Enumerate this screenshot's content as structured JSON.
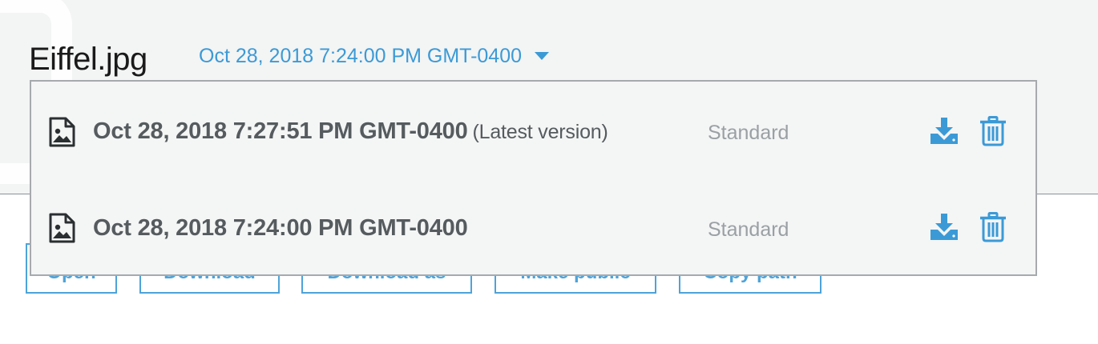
{
  "file": {
    "name": "Eiffel.jpg"
  },
  "version_selector": {
    "selected": "Oct 28, 2018 7:24:00 PM GMT-0400",
    "icon": "caret-down-icon"
  },
  "actions": [
    {
      "label": "Open"
    },
    {
      "label": "Download"
    },
    {
      "label": "Download as"
    },
    {
      "label": "Make public"
    },
    {
      "label": "Copy path"
    }
  ],
  "versions": [
    {
      "date": "Oct 28, 2018 7:27:51 PM GMT-0400",
      "tag": "(Latest version)",
      "storage_class": "Standard",
      "file_icon": "image-file-icon",
      "download_icon": "download-icon",
      "delete_icon": "trash-icon"
    },
    {
      "date": "Oct 28, 2018 7:24:00 PM GMT-0400",
      "tag": "",
      "storage_class": "Standard",
      "file_icon": "image-file-icon",
      "download_icon": "download-icon",
      "delete_icon": "trash-icon"
    }
  ],
  "colors": {
    "accent": "#3b9ad6",
    "header_bg": "#f3f4f4",
    "dropdown_bg": "#f4f5f5",
    "muted_text": "#9aa0a4",
    "strong_text": "#555b5e"
  }
}
